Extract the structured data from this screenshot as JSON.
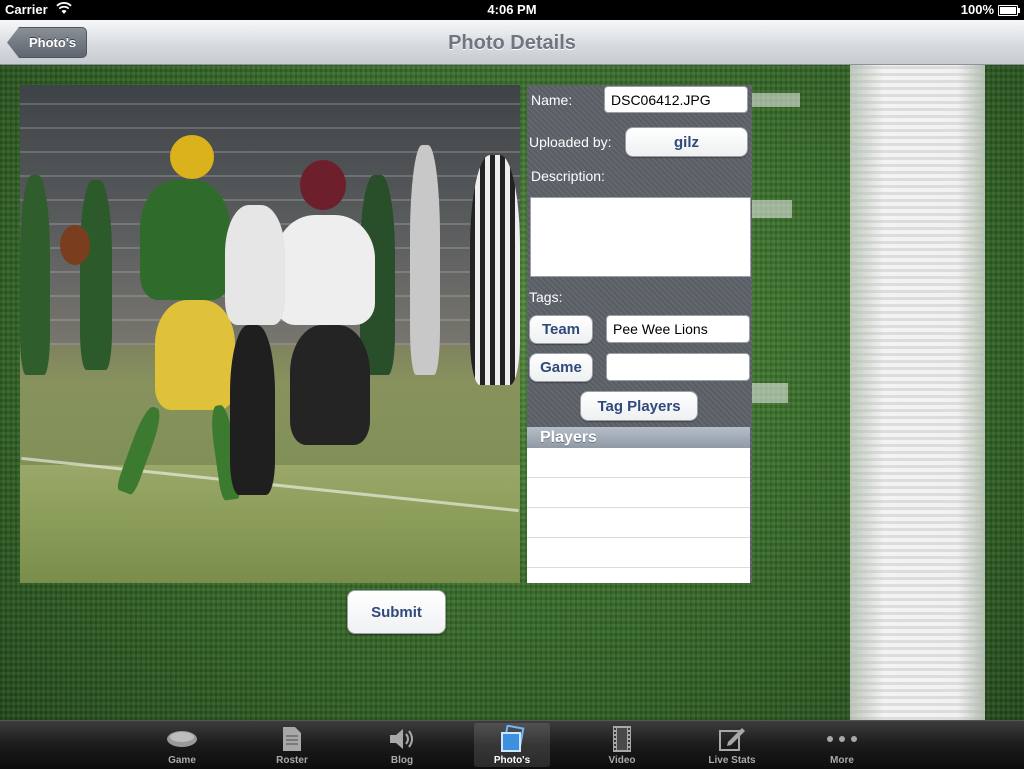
{
  "status_bar": {
    "carrier": "Carrier",
    "time": "4:06 PM",
    "battery": "100%"
  },
  "nav_bar": {
    "back_label": "Photo's",
    "title": "Photo Details"
  },
  "details": {
    "name_label": "Name:",
    "name_value": "DSC06412.JPG",
    "uploaded_by_label": "Uploaded by:",
    "uploaded_by_value": "gilz",
    "description_label": "Description:",
    "description_value": "",
    "tags_label": "Tags:",
    "team_button": "Team",
    "team_value": "Pee Wee  Lions",
    "game_button": "Game",
    "game_value": "",
    "tag_players_button": "Tag Players",
    "players_header": "Players",
    "player_rows": [
      "",
      "",
      "",
      ""
    ]
  },
  "submit_label": "Submit",
  "tab_bar": {
    "tabs": [
      {
        "label": "Game",
        "icon": "football-icon",
        "active": false
      },
      {
        "label": "Roster",
        "icon": "document-icon",
        "active": false
      },
      {
        "label": "Blog",
        "icon": "speaker-icon",
        "active": false
      },
      {
        "label": "Photo's",
        "icon": "photos-icon",
        "active": true
      },
      {
        "label": "Video",
        "icon": "film-icon",
        "active": false
      },
      {
        "label": "Live Stats",
        "icon": "edit-icon",
        "active": false
      },
      {
        "label": "More",
        "icon": "more-icon",
        "active": false
      }
    ]
  },
  "colors": {
    "button_text": "#2f4a7b",
    "panel_bg": "#5d6168",
    "tab_active": "#ffffff"
  }
}
